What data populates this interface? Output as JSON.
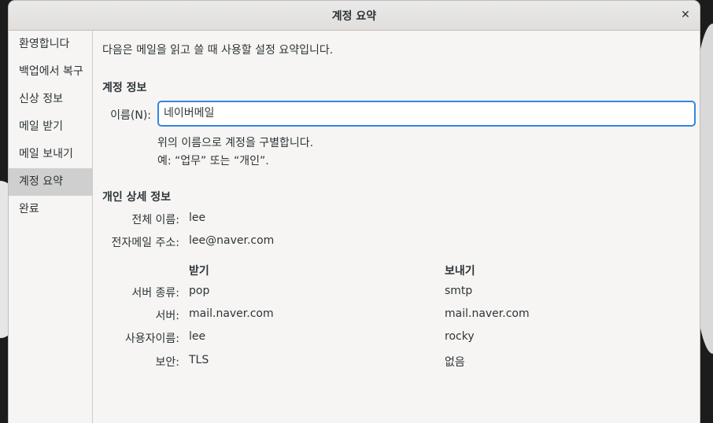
{
  "window": {
    "title": "계정 요약"
  },
  "sidebar": {
    "items": [
      {
        "label": "환영합니다"
      },
      {
        "label": "백업에서 복구"
      },
      {
        "label": "신상 정보"
      },
      {
        "label": "메일 받기"
      },
      {
        "label": "메일 보내기"
      },
      {
        "label": "계정 요약"
      },
      {
        "label": "완료"
      }
    ],
    "active_index": 5
  },
  "main": {
    "intro": "다음은 메일을 읽고 쓸 때 사용할 설정 요약입니다.",
    "account_info": {
      "title": "계정 정보",
      "name_label": "이름(N):",
      "name_value": "네이버메일",
      "hint1": "위의 이름으로 계정을 구별합니다.",
      "hint2": "예: “업무” 또는 “개인”."
    },
    "personal": {
      "title": "개인 상세 정보",
      "full_name_label": "전체 이름:",
      "full_name": "lee",
      "email_label": "전자메일 주소:",
      "email": "lee@naver.com"
    },
    "servers": {
      "receive_header": "받기",
      "send_header": "보내기",
      "rows": [
        {
          "label": "서버 종류:",
          "receive": "pop",
          "send": "smtp"
        },
        {
          "label": "서버:",
          "receive": "mail.naver.com",
          "send": "mail.naver.com"
        },
        {
          "label": "사용자이름:",
          "receive": "lee",
          "send": "rocky"
        },
        {
          "label": "보안:",
          "receive": "TLS",
          "send": "없음"
        }
      ]
    }
  }
}
